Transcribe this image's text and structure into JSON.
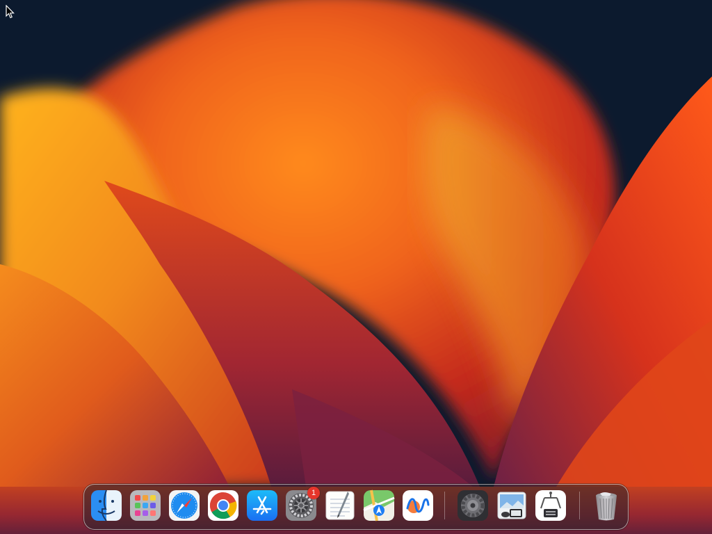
{
  "wallpaper": {
    "name": "macOS Ventura",
    "colors": {
      "background": "#0c1a2e",
      "orange": "#f7931e",
      "deep_orange": "#e0461a",
      "red": "#c1271c",
      "purple": "#6b2140"
    }
  },
  "cursor": {
    "icon": "arrow-pointer-icon"
  },
  "dock": {
    "apps": [
      {
        "id": "finder",
        "icon": "finder-icon"
      },
      {
        "id": "launchpad",
        "icon": "launchpad-icon"
      },
      {
        "id": "safari",
        "icon": "safari-icon"
      },
      {
        "id": "chrome",
        "icon": "chrome-icon"
      },
      {
        "id": "app-store",
        "icon": "app-store-icon"
      },
      {
        "id": "system-preferences",
        "icon": "system-preferences-icon",
        "badge": "1"
      },
      {
        "id": "textedit",
        "icon": "textedit-icon"
      },
      {
        "id": "maps",
        "icon": "maps-icon"
      },
      {
        "id": "freeform",
        "icon": "freeform-icon"
      }
    ],
    "utilities": [
      {
        "id": "settings",
        "icon": "gear-icon"
      },
      {
        "id": "preview",
        "icon": "preview-icon"
      },
      {
        "id": "system-information",
        "icon": "system-information-icon"
      }
    ],
    "trash": {
      "id": "trash",
      "icon": "trash-icon"
    }
  }
}
